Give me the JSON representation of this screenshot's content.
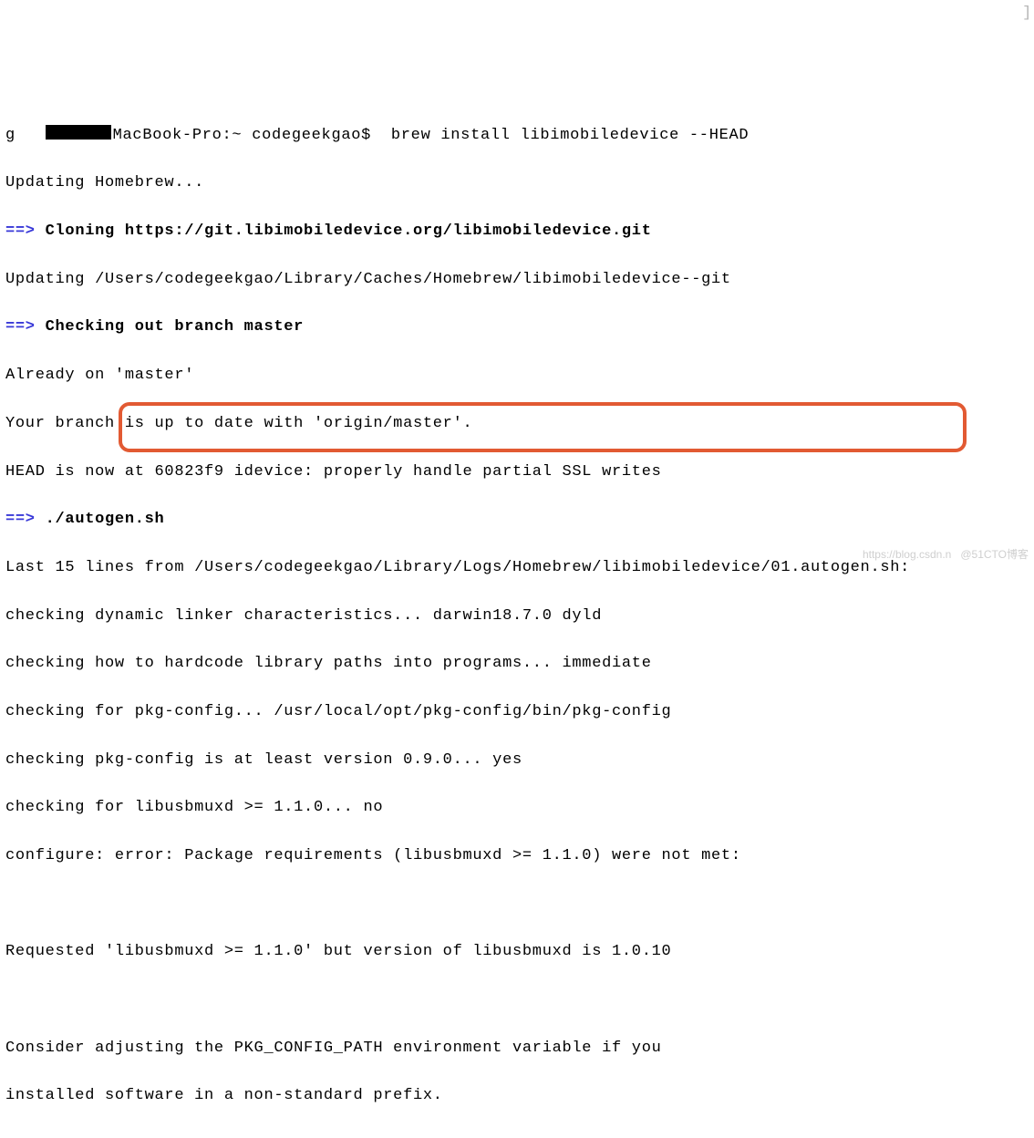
{
  "terminal": {
    "prompt_prefix_obscured": "g   ",
    "host_suffix": "MacBook-Pro:~ codegeekgao$  ",
    "command": "brew install libimobiledevice --HEAD",
    "scroll_end": "]",
    "lines": {
      "updating": "Updating Homebrew...",
      "arrow": "==> ",
      "clone_msg": "Cloning https://git.libimobiledevice.org/libimobiledevice.git",
      "updating_path": "Updating /Users/codegeekgao/Library/Caches/Homebrew/libimobiledevice--git",
      "checkout_msg": "Checking out branch master",
      "already_on": "Already on 'master'",
      "up_to_date": "Your branch is up to date with 'origin/master'.",
      "head_now": "HEAD is now at 60823f9 idevice: properly handle partial SSL writes",
      "autogen": "./autogen.sh",
      "last15": "Last 15 lines from /Users/codegeekgao/Library/Logs/Homebrew/libimobiledevice/01.autogen.sh:",
      "chk1": "checking dynamic linker characteristics... darwin18.7.0 dyld",
      "chk2": "checking how to hardcode library paths into programs... immediate",
      "chk3": "checking for pkg-config... /usr/local/opt/pkg-config/bin/pkg-config",
      "chk4": "checking pkg-config is at least version 0.9.0... yes",
      "chk5": "checking for libusbmuxd >= 1.1.0... no",
      "configure_err": "configure: error: Package requirements (libusbmuxd >= 1.1.0) were not met:",
      "requested": "Requested 'libusbmuxd >= 1.1.0' but version of libusbmuxd is 1.0.10",
      "consider1": "Consider adjusting the PKG_CONFIG_PATH environment variable if you",
      "consider2": "installed software in a non-standard prefix."
    }
  },
  "watermark": "https://blog.csdn.n   @51CTO博客"
}
